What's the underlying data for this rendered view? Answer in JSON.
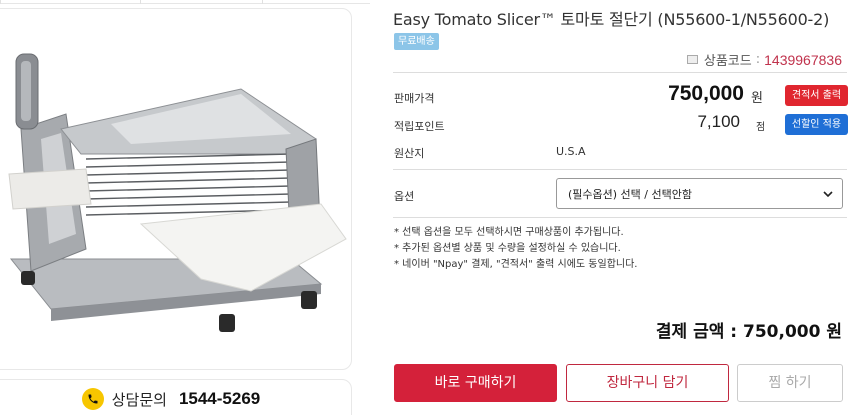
{
  "product": {
    "title": "Easy Tomato Slicer™ 토마토 절단기 (N55600-1/N55600-2)",
    "free_shipping_badge": "무료배송",
    "code_label": "상품코드",
    "code_separator": ":",
    "code_value": "1439967836"
  },
  "price": {
    "label": "판매가격",
    "value": "750,000",
    "unit": "원",
    "quote_button": "견적서 출력"
  },
  "points": {
    "label": "적립포인트",
    "value": "7,100",
    "unit": "점",
    "button": "선할인 적용"
  },
  "origin": {
    "label": "원산지",
    "value": "U.S.A"
  },
  "option": {
    "label": "옵션",
    "selected": "(필수옵션) 선택 / 선택안함"
  },
  "notes": [
    "* 선택 옵션을 모두 선택하시면 구매상품이 추가됩니다.",
    "* 추가된 옵션별 상품 및 수량을 설정하실 수 있습니다.",
    "* 네이버 \"Npay\" 결제, \"견적서\" 출력 시에도 동일합니다."
  ],
  "total": "결제 금액 : 750,000 원",
  "actions": {
    "buy": "바로 구매하기",
    "cart": "장바구니 담기",
    "wish": "찜 하기"
  },
  "consult": {
    "label": "상담문의",
    "number": "1544-5269"
  },
  "colors": {
    "accent_red": "#d4213a",
    "blue": "#1f6fd6",
    "badge_blue": "#8cc5e8",
    "phone_yellow": "#f7c600"
  }
}
